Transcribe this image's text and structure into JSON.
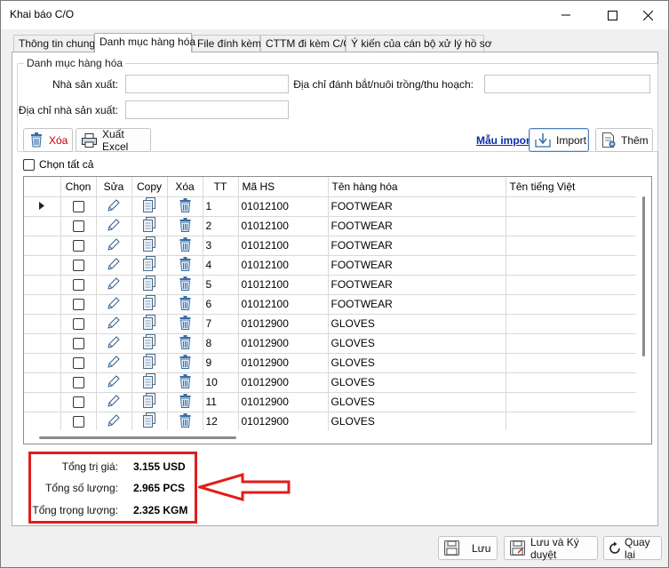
{
  "window": {
    "title": "Khai báo C/O"
  },
  "tabs": [
    {
      "label": "Thông tin chung"
    },
    {
      "label": "Danh mục hàng hóa"
    },
    {
      "label": "File đính kèm"
    },
    {
      "label": "CTTM đi kèm C/O"
    },
    {
      "label": "Ý kiến của cán bộ xử lý hồ sơ"
    }
  ],
  "group": {
    "legend": "Danh mục hàng hóa",
    "manufacturer_label": "Nhà sản xuất:",
    "manufacturer_value": "",
    "manufacturer_address_label": "Địa chỉ nhà sản xuất:",
    "manufacturer_address_value": "",
    "origin_address_label": "Địa chỉ đánh bắt/nuôi trồng/thu hoạch:",
    "origin_address_value": ""
  },
  "toolbar": {
    "delete_label": "Xóa",
    "export_excel_label": "Xuất Excel",
    "template_link": "Mẫu import",
    "import_label": "Import",
    "add_label": "Thêm"
  },
  "select_all_label": "Chọn tất cả",
  "grid": {
    "columns": [
      "Chọn",
      "Sửa",
      "Copy",
      "Xóa",
      "TT",
      "Mã HS",
      "Tên hàng hóa",
      "Tên tiếng Việt"
    ],
    "rows": [
      {
        "tt": "1",
        "hs": "01012100",
        "name": "FOOTWEAR",
        "vn": ""
      },
      {
        "tt": "2",
        "hs": "01012100",
        "name": "FOOTWEAR",
        "vn": ""
      },
      {
        "tt": "3",
        "hs": "01012100",
        "name": "FOOTWEAR",
        "vn": ""
      },
      {
        "tt": "4",
        "hs": "01012100",
        "name": "FOOTWEAR",
        "vn": ""
      },
      {
        "tt": "5",
        "hs": "01012100",
        "name": "FOOTWEAR",
        "vn": ""
      },
      {
        "tt": "6",
        "hs": "01012100",
        "name": "FOOTWEAR",
        "vn": ""
      },
      {
        "tt": "7",
        "hs": "01012900",
        "name": "GLOVES",
        "vn": ""
      },
      {
        "tt": "8",
        "hs": "01012900",
        "name": "GLOVES",
        "vn": ""
      },
      {
        "tt": "9",
        "hs": "01012900",
        "name": "GLOVES",
        "vn": ""
      },
      {
        "tt": "10",
        "hs": "01012900",
        "name": "GLOVES",
        "vn": ""
      },
      {
        "tt": "11",
        "hs": "01012900",
        "name": "GLOVES",
        "vn": ""
      },
      {
        "tt": "12",
        "hs": "01012900",
        "name": "GLOVES",
        "vn": ""
      }
    ]
  },
  "totals": {
    "value_label": "Tổng trị giá:",
    "value": "3.155 USD",
    "quantity_label": "Tổng số lượng:",
    "quantity": "2.965 PCS",
    "weight_label": "Tổng trọng lượng:",
    "weight": "2.325 KGM"
  },
  "footer": {
    "save_label": "Lưu",
    "save_sign_label": "Lưu và Ký duyệt",
    "back_label": "Quay lại"
  },
  "colors": {
    "highlight_border": "#e11d1d",
    "link": "#0a2ea7",
    "delete_text": "#c00000"
  }
}
